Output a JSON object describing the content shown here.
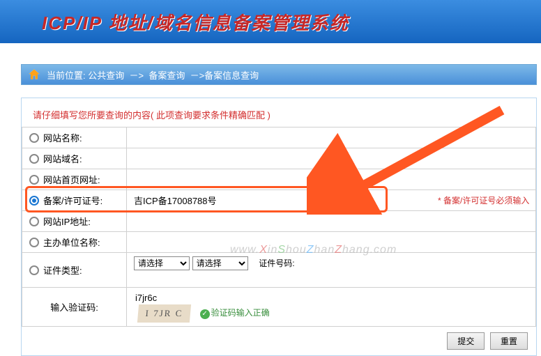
{
  "header": {
    "title": "ICP/IP 地址/域名信息备案管理系统"
  },
  "breadcrumb": {
    "label": "当前位置:",
    "path1": "公共查询",
    "sep": "－>",
    "path2": "备案查询",
    "path3": "备案信息查询"
  },
  "instruction": "请仔细填写您所要查询的内容( 此项查询要求条件精确匹配 )",
  "fields": {
    "site_name": {
      "label": "网站名称:",
      "value": ""
    },
    "site_domain": {
      "label": "网站域名:",
      "value": ""
    },
    "site_url": {
      "label": "网站首页网址:",
      "value": ""
    },
    "license_no": {
      "label": "备案/许可证号:",
      "value": "吉ICP备17008788号",
      "required_note": "* 备案/许可证号必须输入"
    },
    "site_ip": {
      "label": "网站IP地址:",
      "value": ""
    },
    "org_name": {
      "label": "主办单位名称:",
      "value": ""
    },
    "cert_type": {
      "label": "证件类型:",
      "select_default": "请选择",
      "cert_no_label": "证件号码:",
      "cert_no_value": ""
    },
    "captcha": {
      "label": "输入验证码:",
      "value": "i7jr6c",
      "image_text": "I 7JR C",
      "ok_text": "验证码输入正确"
    }
  },
  "buttons": {
    "submit": "提交",
    "reset": "重置"
  },
  "watermark": "www.XinShouZhanZhang.com"
}
